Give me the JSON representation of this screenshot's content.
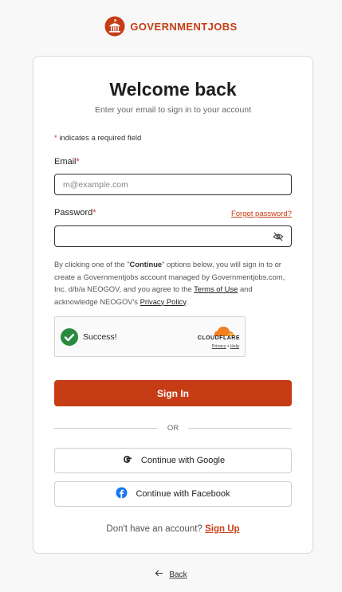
{
  "brand": {
    "name_part1": "GOVERNMENT",
    "name_part2": "JOBS",
    "color": "#c63d15"
  },
  "login": {
    "title": "Welcome back",
    "subtitle": "Enter your email to sign in to your account",
    "required_note": "indicates a required field",
    "required_marker": "*",
    "email_label": "Email",
    "email_placeholder": "m@example.com",
    "email_value": "",
    "password_label": "Password",
    "password_value": "",
    "forgot_password": "Forgot password?",
    "consent": {
      "part1": "By clicking one of the \"",
      "continue_word": "Continue",
      "part2": "\" options below, you will sign in to or create a Governmentjobs account managed by Governmentjobs.com, Inc. d/b/a NEOGOV, and you agree to the",
      "terms_link": "Terms of Use",
      "part3": "and acknowledge NEOGOV's",
      "privacy_link": "Privacy Policy",
      "part4": "."
    },
    "captcha": {
      "status": "Success!",
      "provider": "CLOUDFLARE",
      "privacy": "Privacy",
      "separator": "•",
      "help": "Help"
    },
    "sign_in_button": "Sign In",
    "or_text": "OR",
    "google_button": "Continue with Google",
    "facebook_button": "Continue with Facebook",
    "no_account_text": "Don't have an account?",
    "sign_up_link": "Sign Up"
  },
  "footer": {
    "back_label": "Back"
  },
  "colors": {
    "accent": "#c63d15",
    "success": "#2a8a3e",
    "facebook": "#1877f2",
    "cloudflare": "#f38020"
  },
  "icons": [
    "capitol-logo-icon",
    "eye-off-icon",
    "check-circle-icon",
    "cloudflare-logo-icon",
    "google-icon",
    "facebook-icon",
    "arrow-left-icon"
  ]
}
